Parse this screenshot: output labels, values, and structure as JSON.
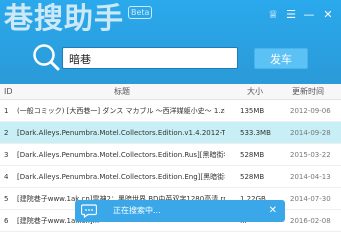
{
  "window": {
    "title": "巷搜助手",
    "badge": "Beta",
    "buttons": {
      "shirt": "♕",
      "menu": "☰",
      "minimize": "—",
      "close": "✕"
    }
  },
  "search": {
    "query": "暗巷",
    "button_label": "发车"
  },
  "table": {
    "headers": {
      "id": "ID",
      "title": "标题",
      "size": "大小",
      "date": "更新时间"
    },
    "rows": [
      {
        "id": "1",
        "title": "(一般コミック) [大西巷一] ダンス マカブル ～西洋媒躯小史～ 1.zip",
        "size": "135MB",
        "date": "2012-09-06"
      },
      {
        "id": "2",
        "title": "[Dark.Alleys.Penumbra.Motel.Collectors.Edition.v1.4.2012-TE][黑...",
        "size": "533.3MB",
        "date": "2014-09-28"
      },
      {
        "id": "3",
        "title": "[Dark.Alleys.Penumbra.Motel.Collectors.Edition.Rus][黑暗街巷：?",
        "size": "528MB",
        "date": "2015-03-22"
      },
      {
        "id": "4",
        "title": "[Dark.Alleys.Penumbra.Motel.Collectors.Edition.Eng][黑暗街巷：?",
        "size": "528MB",
        "date": "2014-04-13"
      },
      {
        "id": "5",
        "title": "[建院巷子www.1ak.cn]雷神2：黑暗世界.BD中英双字1280高清.rmvb",
        "size": "1.22GB",
        "date": "2014-07-30"
      },
      {
        "id": "6",
        "title": "[建院巷子www.1ak.cn]...",
        "size": "...",
        "date": "2016-02-08"
      }
    ],
    "selected_index": 1
  },
  "toast": {
    "text": "正在搜索中...",
    "close": "✕"
  },
  "colors": {
    "header": "#2b9ad8",
    "button": "#5cc2f5",
    "selected_row": "#c8eef6",
    "toast": "#3aa8e8"
  }
}
